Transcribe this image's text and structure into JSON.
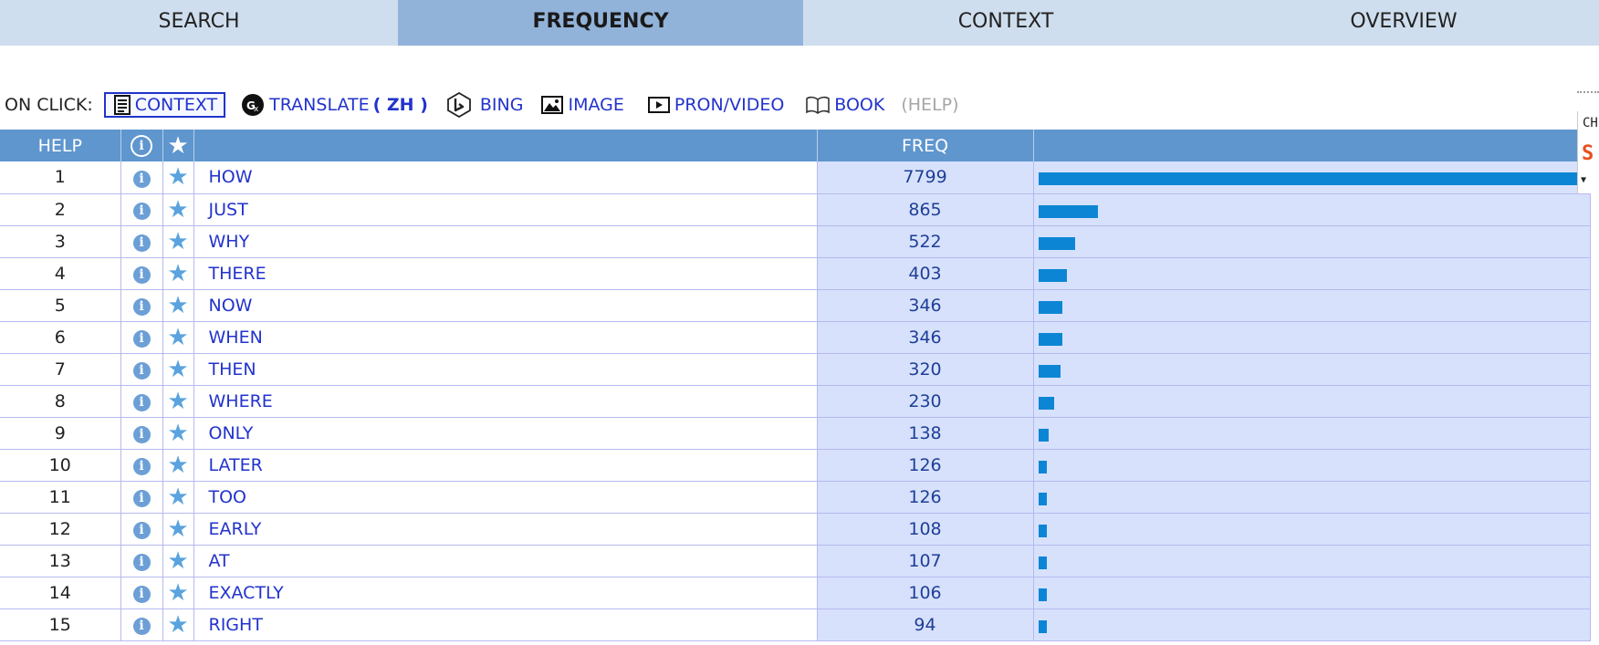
{
  "tabs": [
    {
      "label": "SEARCH",
      "active": false
    },
    {
      "label": "FREQUENCY",
      "active": true
    },
    {
      "label": "CONTEXT",
      "active": false
    },
    {
      "label": "OVERVIEW",
      "active": false
    }
  ],
  "onclick": {
    "label": "ON CLICK:",
    "options": {
      "context": {
        "label": "CONTEXT",
        "icon": "document-icon"
      },
      "translate": {
        "label": "TRANSLATE",
        "lang": "( ZH )",
        "icon": "google-translate-icon"
      },
      "bing": {
        "label": "BING",
        "icon": "bing-icon"
      },
      "image": {
        "label": "IMAGE",
        "icon": "image-icon"
      },
      "pron": {
        "label": "PRON/VIDEO",
        "icon": "video-icon"
      },
      "book": {
        "label": "BOOK",
        "icon": "book-icon"
      }
    },
    "help": "(HELP)"
  },
  "table": {
    "headers": {
      "help": "HELP",
      "info": "i",
      "star": "★",
      "word": "",
      "freq": "FREQ",
      "bar": ""
    },
    "rows": [
      {
        "rank": "1",
        "word": "HOW",
        "freq": "7799",
        "bar": 1.0
      },
      {
        "rank": "2",
        "word": "JUST",
        "freq": "865",
        "bar": 0.111
      },
      {
        "rank": "3",
        "word": "WHY",
        "freq": "522",
        "bar": 0.067
      },
      {
        "rank": "4",
        "word": "THERE",
        "freq": "403",
        "bar": 0.052
      },
      {
        "rank": "5",
        "word": "NOW",
        "freq": "346",
        "bar": 0.044
      },
      {
        "rank": "6",
        "word": "WHEN",
        "freq": "346",
        "bar": 0.044
      },
      {
        "rank": "7",
        "word": "THEN",
        "freq": "320",
        "bar": 0.041
      },
      {
        "rank": "8",
        "word": "WHERE",
        "freq": "230",
        "bar": 0.029
      },
      {
        "rank": "9",
        "word": "ONLY",
        "freq": "138",
        "bar": 0.018
      },
      {
        "rank": "10",
        "word": "LATER",
        "freq": "126",
        "bar": 0.016
      },
      {
        "rank": "11",
        "word": "TOO",
        "freq": "126",
        "bar": 0.016
      },
      {
        "rank": "12",
        "word": "EARLY",
        "freq": "108",
        "bar": 0.014
      },
      {
        "rank": "13",
        "word": "AT",
        "freq": "107",
        "bar": 0.014
      },
      {
        "rank": "14",
        "word": "EXACTLY",
        "freq": "106",
        "bar": 0.014
      },
      {
        "rank": "15",
        "word": "RIGHT",
        "freq": "94",
        "bar": 0.012
      }
    ]
  },
  "edge_widget": {
    "text": "CH"
  },
  "colors": {
    "header": "#5f96ce",
    "tab_bg": "#cfdeee",
    "tab_active": "#92b3d9",
    "link": "#2233cc",
    "bar": "#0c86d4",
    "freq_bg": "#d7e1fc"
  }
}
